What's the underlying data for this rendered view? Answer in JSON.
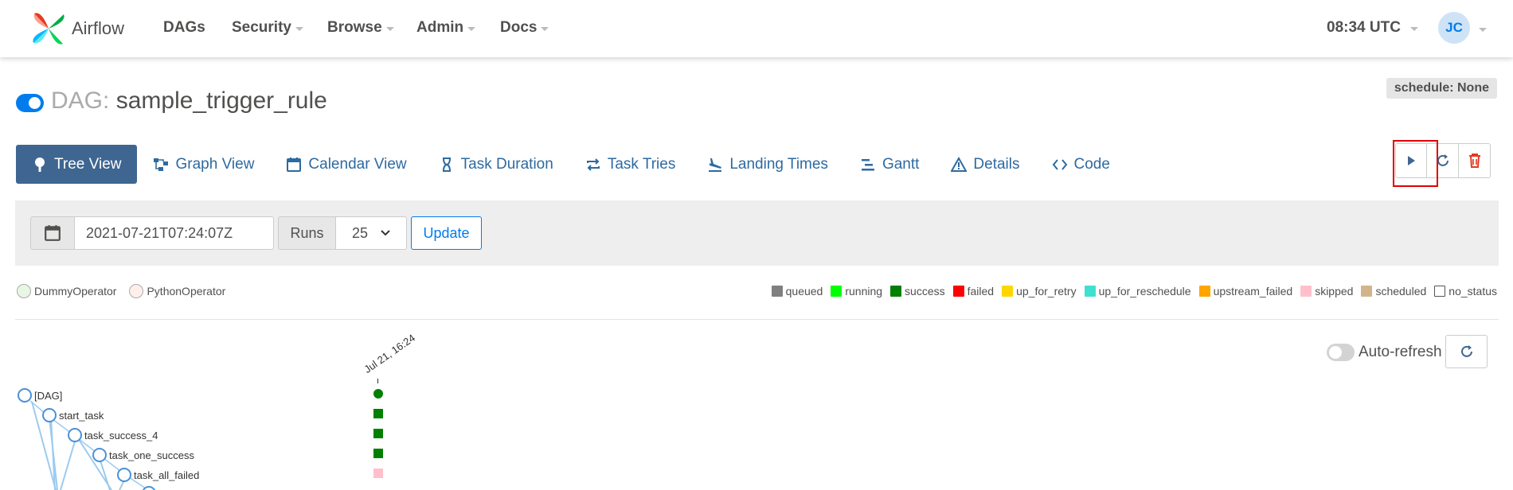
{
  "navbar": {
    "brand": "Airflow",
    "items": [
      {
        "label": "DAGs",
        "dropdown": false
      },
      {
        "label": "Security",
        "dropdown": true
      },
      {
        "label": "Browse",
        "dropdown": true
      },
      {
        "label": "Admin",
        "dropdown": true
      },
      {
        "label": "Docs",
        "dropdown": true
      }
    ],
    "time": "08:34 UTC",
    "user_initials": "JC"
  },
  "dag": {
    "prefix": "DAG:",
    "name": "sample_trigger_rule",
    "active": true,
    "schedule": "schedule: None"
  },
  "views": [
    {
      "label": "Tree View",
      "icon": "tree-icon",
      "active": true
    },
    {
      "label": "Graph View",
      "icon": "graph-icon",
      "active": false
    },
    {
      "label": "Calendar View",
      "icon": "calendar-icon",
      "active": false
    },
    {
      "label": "Task Duration",
      "icon": "hourglass-icon",
      "active": false
    },
    {
      "label": "Task Tries",
      "icon": "retry-icon",
      "active": false
    },
    {
      "label": "Landing Times",
      "icon": "landing-icon",
      "active": false
    },
    {
      "label": "Gantt",
      "icon": "gantt-icon",
      "active": false
    },
    {
      "label": "Details",
      "icon": "warning-icon",
      "active": false
    },
    {
      "label": "Code",
      "icon": "code-icon",
      "active": false
    }
  ],
  "actions": [
    "trigger-dag-icon",
    "refresh-icon",
    "delete-icon"
  ],
  "filter": {
    "base_date": "2021-07-21T07:24:07Z",
    "runs_label": "Runs",
    "runs_value": "25",
    "update_label": "Update"
  },
  "operators": [
    {
      "label": "DummyOperator",
      "color": "#e8f7e4",
      "border": "#aaaaaa"
    },
    {
      "label": "PythonOperator",
      "color": "#ffefeb",
      "border": "#aaaaaa"
    }
  ],
  "states": [
    {
      "label": "queued",
      "color": "#808080"
    },
    {
      "label": "running",
      "color": "#00ff00"
    },
    {
      "label": "success",
      "color": "#008000"
    },
    {
      "label": "failed",
      "color": "#ff0000"
    },
    {
      "label": "up_for_retry",
      "color": "#ffd700"
    },
    {
      "label": "up_for_reschedule",
      "color": "#40e0d0"
    },
    {
      "label": "upstream_failed",
      "color": "#ffa500"
    },
    {
      "label": "skipped",
      "color": "#ffc0cb"
    },
    {
      "label": "scheduled",
      "color": "#d2b48c"
    },
    {
      "label": "no_status",
      "color": "#ffffff"
    }
  ],
  "auto_refresh": {
    "label": "Auto-refresh",
    "enabled": false
  },
  "tree": {
    "run_date": "Jul 21, 16:24",
    "nodes": [
      {
        "label": "[DAG]",
        "state": "success"
      },
      {
        "label": "start_task",
        "state": "success"
      },
      {
        "label": "task_success_4",
        "state": "success"
      },
      {
        "label": "task_one_success",
        "state": "success"
      },
      {
        "label": "task_all_failed",
        "state": "skipped"
      },
      {
        "label": "",
        "state": "no_status"
      }
    ]
  }
}
